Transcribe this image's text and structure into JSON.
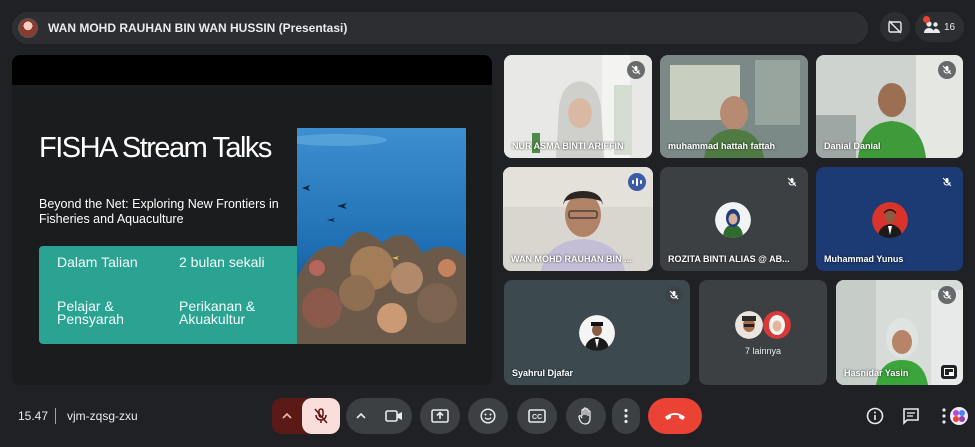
{
  "topbar": {
    "title": "WAN MOHD RAUHAN BIN WAN HUSSIN (Presentasi)",
    "people_count": "16"
  },
  "slide": {
    "title": "FISHA Stream Talks",
    "subtitle": "Beyond the Net: Exploring New Frontiers in Fisheries and Aquaculture",
    "items": [
      "Dalam Talian",
      "2 bulan sekali",
      "Pelajar & Pensyarah",
      "Perikanan & Akuakultur"
    ],
    "accent": "#2ba393"
  },
  "participants": [
    {
      "name": "NUR ASMA BINTI ARIFFIN",
      "muted": true
    },
    {
      "name": "muhammad hattah fattah",
      "muted": false
    },
    {
      "name": "Danial Danial",
      "muted": true
    },
    {
      "name": "WAN MOHD RAUHAN BIN ...",
      "muted": false,
      "speaking": true
    },
    {
      "name": "ROZITA BINTI ALIAS @ AB...",
      "muted": true
    },
    {
      "name": "Muhammad Yunus",
      "muted": true
    },
    {
      "name": "Syahrul Djafar",
      "muted": true
    },
    {
      "name": "Hasnidar Yasin",
      "muted": true
    }
  ],
  "others": {
    "label": "7 lainnya"
  },
  "bottombar": {
    "time": "15.47",
    "meeting_code": "vjm-zqsg-zxu"
  },
  "icons": {
    "hide_self": "hide-self-view-icon",
    "people": "people-icon",
    "mic": "mic-off-icon",
    "camera": "camera-icon",
    "present": "present-screen-icon",
    "emoji": "emoji-icon",
    "captions": "captions-icon",
    "hand": "raise-hand-icon",
    "more": "more-options-icon",
    "end": "end-call-icon",
    "info": "info-icon",
    "chat": "chat-icon",
    "activities": "activities-icon"
  },
  "colors": {
    "end_call": "#ea4335",
    "mic_muted_bg": "#f9dedc",
    "active_tile": "#a8c7fa"
  }
}
